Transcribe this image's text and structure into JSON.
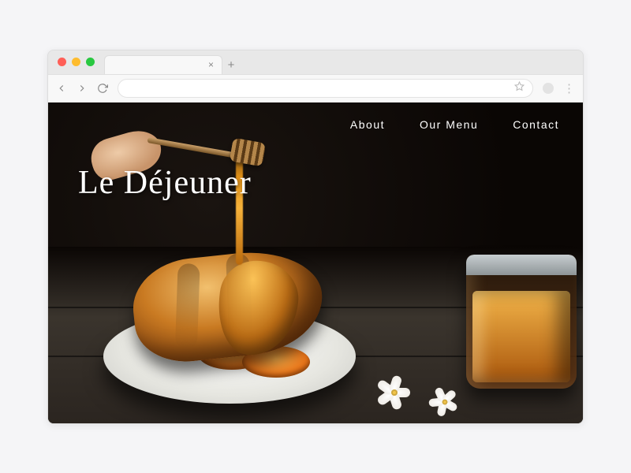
{
  "nav": {
    "items": [
      {
        "label": "About"
      },
      {
        "label": "Our Menu"
      },
      {
        "label": "Contact"
      }
    ]
  },
  "site": {
    "title": "Le Déjeuner"
  }
}
